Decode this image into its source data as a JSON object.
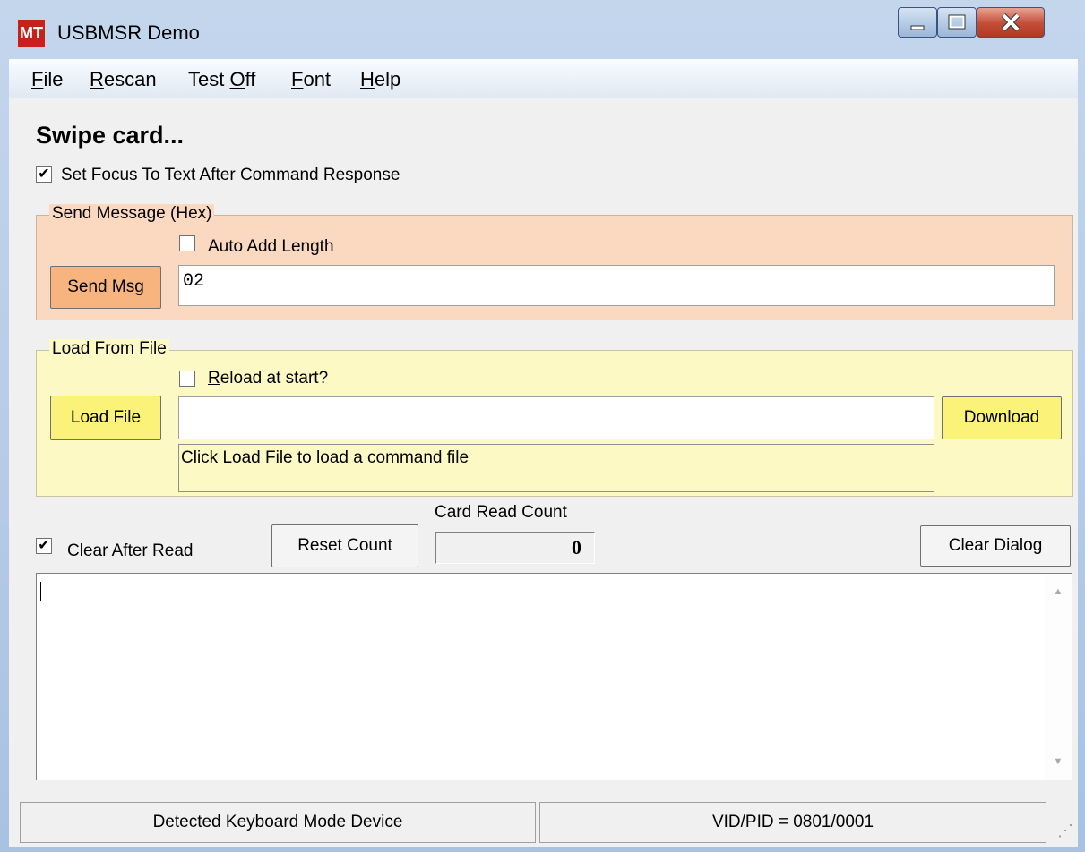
{
  "window": {
    "title": "USBMSR Demo",
    "icon_text": "MT"
  },
  "menu": [
    {
      "pre": "",
      "key": "F",
      "post": "ile"
    },
    {
      "pre": "",
      "key": "R",
      "post": "escan"
    },
    {
      "pre": "Test ",
      "key": "O",
      "post": "ff"
    },
    {
      "pre": "",
      "key": "F",
      "post": "ont"
    },
    {
      "pre": "",
      "key": "H",
      "post": "elp"
    }
  ],
  "heading": "Swipe card...",
  "focus_checkbox": {
    "label": "Set Focus To Text After Command Response",
    "checked": true
  },
  "send_group": {
    "legend": "Send Message (Hex)",
    "auto_length_label": "Auto Add Length",
    "auto_length_checked": false,
    "button": "Send Msg",
    "value": "02"
  },
  "load_group": {
    "legend": "Load From File",
    "reload_pre": "",
    "reload_key": "R",
    "reload_post": "eload at start?",
    "reload_checked": false,
    "load_button": "Load File",
    "file_value": "",
    "download_button": "Download",
    "status": "Click Load File to load a command file"
  },
  "counter": {
    "clear_after_label": "Clear After Read",
    "clear_after_checked": true,
    "reset_button": "Reset Count",
    "count_label": "Card Read Count",
    "count": "0",
    "clear_dialog_button": "Clear Dialog"
  },
  "status_bar": {
    "left": "Detected Keyboard Mode Device",
    "right": "VID/PID = 0801/0001"
  },
  "colors": {
    "send_bg": "#fad9c0",
    "load_bg": "#fdf9c4",
    "send_btn": "#f7b47f",
    "load_btn": "#fbf27a"
  }
}
